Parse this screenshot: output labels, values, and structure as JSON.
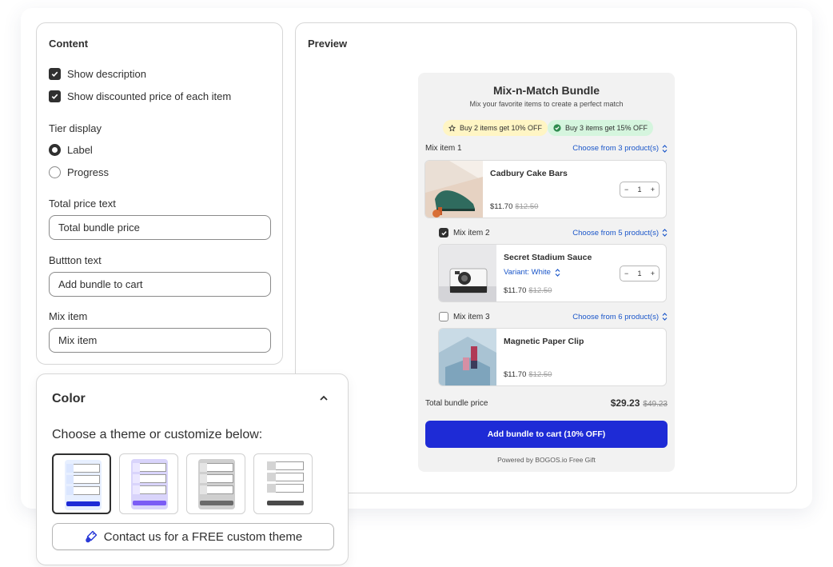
{
  "content": {
    "title": "Content",
    "show_description": "Show description",
    "show_discounted": "Show discounted price of each item",
    "tier_display_label": "Tier display",
    "tier_options": [
      "Label",
      "Progress"
    ],
    "total_price_label": "Total price text",
    "total_price_value": "Total bundle price",
    "button_text_label": "Buttton text",
    "button_text_value": "Add bundle to cart",
    "mix_item_label": "Mix item",
    "mix_item_value": "Mix item"
  },
  "preview": {
    "title": "Preview",
    "bundle_title": "Mix-n-Match Bundle",
    "bundle_subtitle": "Mix your favorite items to create a perfect match",
    "badges": [
      "Buy 2 items get 10% OFF",
      "Buy 3 items get 15% OFF"
    ],
    "mix_items": [
      {
        "label": "Mix item 1",
        "choose": "Choose from 3 product(s)",
        "product": "Cadbury Cake Bars",
        "price": "$11.70",
        "compare": "$12.50",
        "qty": "1"
      },
      {
        "label": "Mix item 2",
        "choose": "Choose from 5 product(s)",
        "product": "Secret Stadium Sauce",
        "variant": "Variant: White",
        "price": "$11.70",
        "compare": "$12.50",
        "qty": "1"
      },
      {
        "label": "Mix item 3",
        "choose": "Choose from 6 product(s)",
        "product": "Magnetic Paper Clip",
        "price": "$11.70",
        "compare": "$12.50"
      }
    ],
    "total_label": "Total bundle price",
    "total_value": "$29.23",
    "total_compare": "$49.23",
    "add_button": "Add bundle to cart (10% OFF)",
    "powered_by": "Powered by BOGOS.io Free Gift"
  },
  "color": {
    "title": "Color",
    "subtitle": "Choose a theme or customize below:",
    "contact_button": "Contact us for a FREE custom theme",
    "theme_accents": [
      "#1e2bd6",
      "#7b5cf5",
      "#6a6a6a",
      "#4a4a4a"
    ]
  }
}
